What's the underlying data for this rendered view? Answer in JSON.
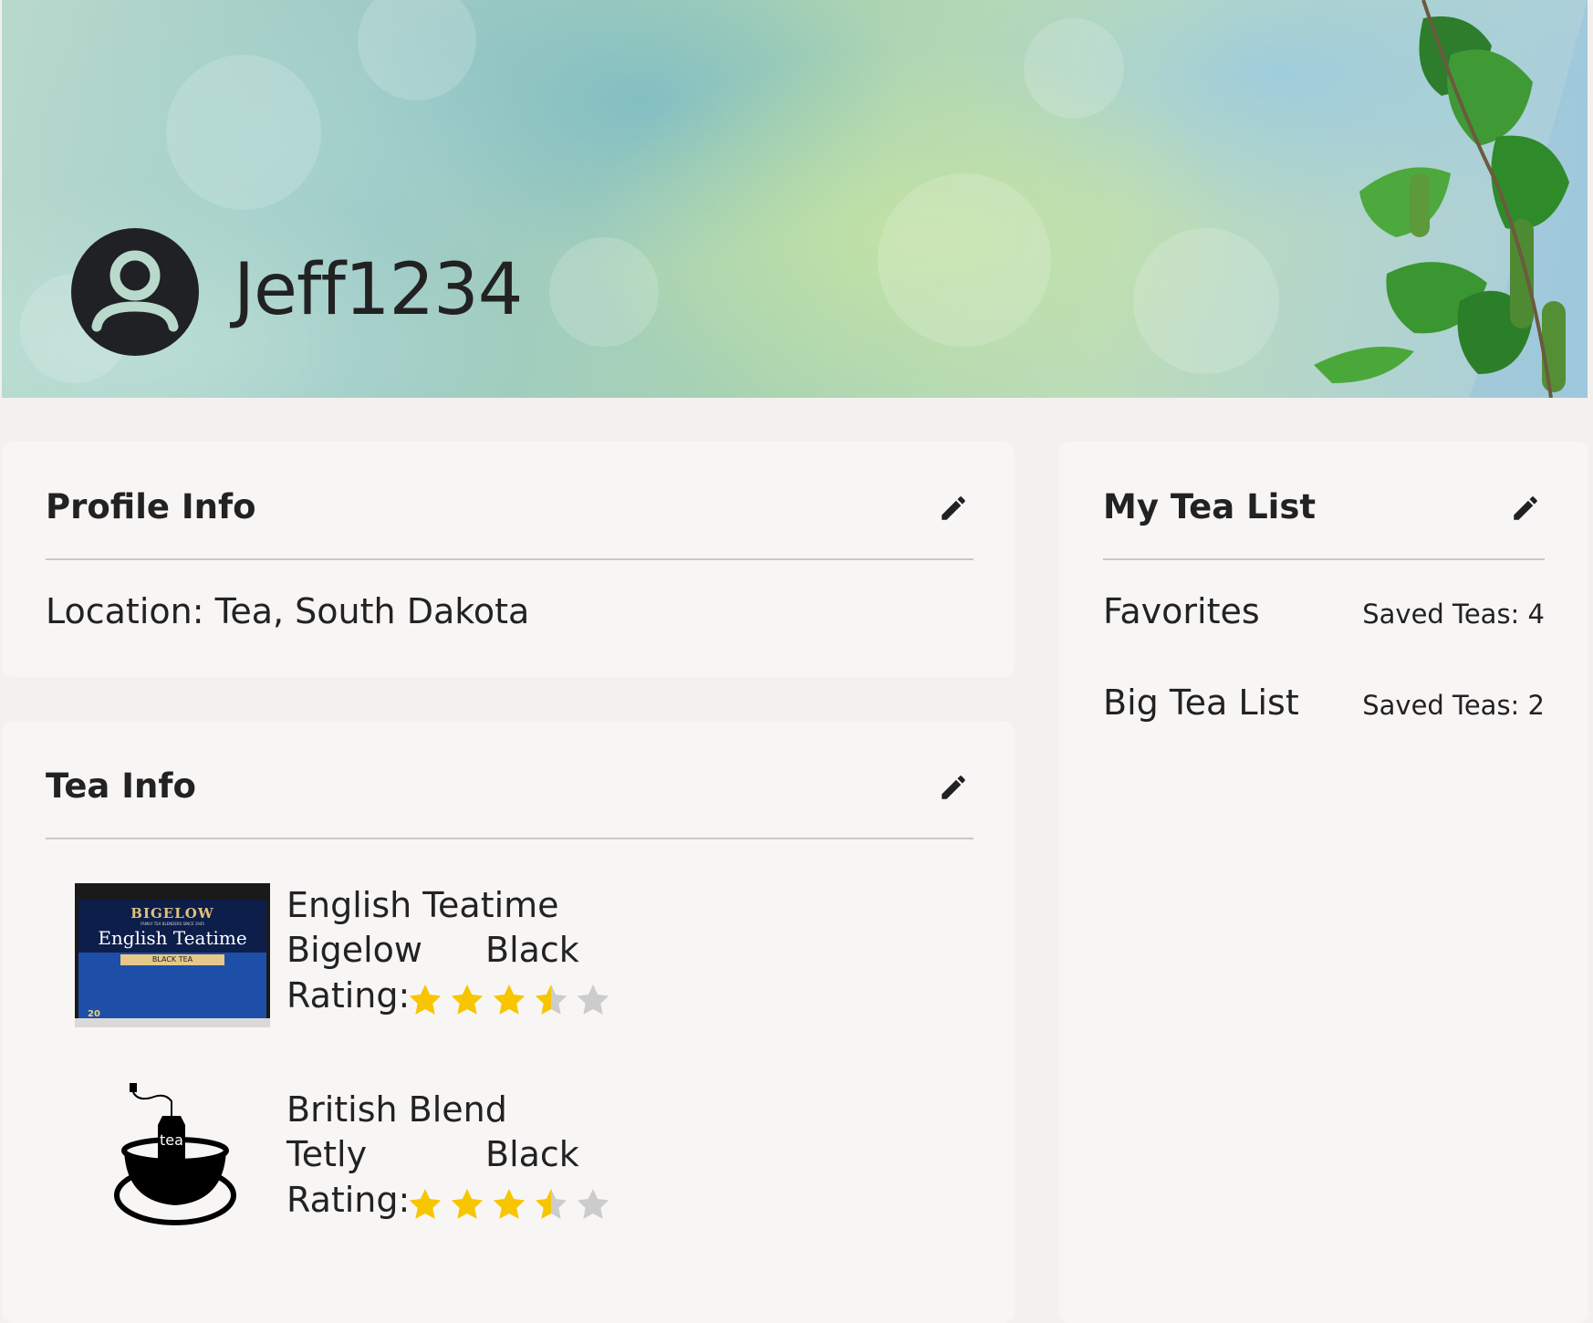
{
  "header": {
    "username": "Jeff1234",
    "avatar_icon": "account-circle-icon"
  },
  "profile_info": {
    "title": "Profile Info",
    "edit_icon": "pencil-icon",
    "location_label": "Location:",
    "location_value": "Tea, South Dakota",
    "location_text": "Location: Tea, South Dakota"
  },
  "tea_info": {
    "title": "Tea Info",
    "edit_icon": "pencil-icon",
    "rating_label": "Rating:",
    "teas": [
      {
        "name": "English Teatime",
        "brand": "Bigelow",
        "type": "Black",
        "rating": 3.5,
        "max_rating": 5,
        "image_icon": "bigelow-box-image",
        "box_brand": "BIGELOW",
        "box_tagline": "FAMILY TEA BLENDERS SINCE 1945",
        "box_name": "English Teatime",
        "box_type": "BLACK TEA",
        "box_count": "20"
      },
      {
        "name": "British Blend",
        "brand": "Tetly",
        "type": "Black",
        "rating": 3.5,
        "max_rating": 5,
        "image_icon": "teacup-icon",
        "cup_label": "tea"
      }
    ]
  },
  "tea_list": {
    "title": "My Tea List",
    "edit_icon": "pencil-icon",
    "lists": [
      {
        "name": "Favorites",
        "count_text": "Saved Teas: 4"
      },
      {
        "name": "Big Tea List",
        "count_text": "Saved Teas: 2"
      }
    ]
  },
  "colors": {
    "star_filled": "#f7c600",
    "star_empty": "#cccccc",
    "card_bg": "#f8f6f5",
    "page_bg": "#f2f1ef"
  }
}
